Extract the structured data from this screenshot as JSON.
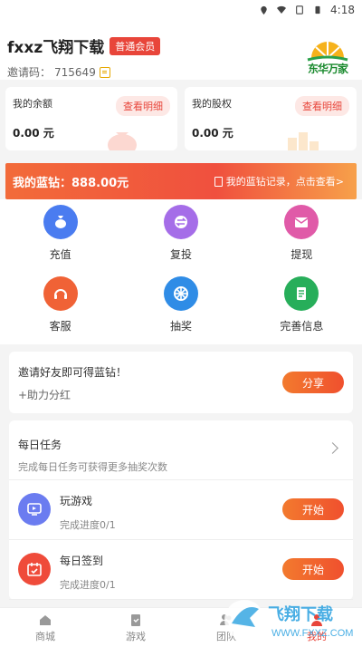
{
  "status": {
    "time": "4:18"
  },
  "header": {
    "username": "fxxz飞翔下载",
    "badge": "普通会员",
    "invite_label": "邀请码：",
    "invite_code": "715649",
    "logo_text": "东华万家"
  },
  "cards": [
    {
      "title": "我的余额",
      "value": "0.00 元",
      "button": "查看明细"
    },
    {
      "title": "我的股权",
      "value": "0.00 元",
      "button": "查看明细"
    }
  ],
  "diamond": {
    "label": "我的蓝钻：888.00元",
    "link": "我的蓝钻记录，点击查看>"
  },
  "grid": [
    {
      "label": "充值",
      "icon": "money-bag-icon",
      "color": "#4a7cf0"
    },
    {
      "label": "复投",
      "icon": "exchange-icon",
      "color": "#a56de8"
    },
    {
      "label": "提现",
      "icon": "envelope-icon",
      "color": "#e05aa8"
    },
    {
      "label": "客服",
      "icon": "headset-icon",
      "color": "#f06236"
    },
    {
      "label": "抽奖",
      "icon": "wheel-icon",
      "color": "#2f8ce6"
    },
    {
      "label": "完善信息",
      "icon": "document-icon",
      "color": "#27ae5a"
    }
  ],
  "invite": {
    "title": "邀请好友即可得蓝钻！",
    "sub": "+助力分红",
    "button": "分享"
  },
  "daily": {
    "title": "每日任务",
    "sub": "完成每日任务可获得更多抽奖次数"
  },
  "tasks": [
    {
      "name": "玩游戏",
      "progress": "完成进度0/1",
      "button": "开始",
      "icon": "play-icon",
      "color": "#6b7cf0"
    },
    {
      "name": "每日签到",
      "progress": "完成进度0/1",
      "button": "开始",
      "icon": "calendar-check-icon",
      "color": "#ef4b3a"
    }
  ],
  "nav": [
    {
      "label": "商城",
      "icon": "home-icon"
    },
    {
      "label": "游戏",
      "icon": "clipboard-icon"
    },
    {
      "label": "团队",
      "icon": "team-icon"
    },
    {
      "label": "我的",
      "icon": "user-icon"
    }
  ],
  "watermark": {
    "text": "飞翔下载",
    "url": "WWW.FXXZ.COM"
  }
}
